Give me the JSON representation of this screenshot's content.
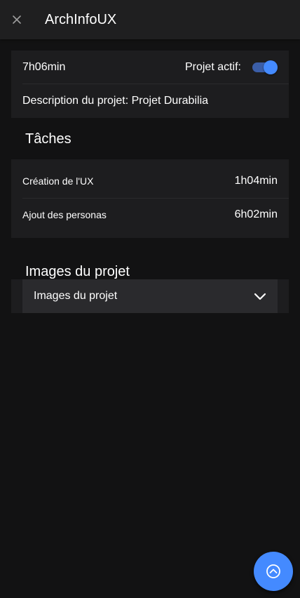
{
  "header": {
    "title": "ArchInfoUX",
    "close_icon": "close-icon"
  },
  "project": {
    "total_time": "7h06min",
    "active_label": "Projet actif:",
    "active": true,
    "description": "Description du projet: Projet Durabilia"
  },
  "tasks": {
    "title": "Tâches",
    "items": [
      {
        "name": "Création de l'UX",
        "time": "1h04min"
      },
      {
        "name": "Ajout des personas",
        "time": "6h02min"
      }
    ]
  },
  "images": {
    "title": "Images du projet",
    "panel_label": "Images du projet",
    "expand_icon": "chevron-down-icon"
  },
  "fab": {
    "icon": "chevron-up-circle-icon"
  },
  "colors": {
    "background": "#121213",
    "card": "#1d1d1f",
    "accent": "#448aff"
  }
}
